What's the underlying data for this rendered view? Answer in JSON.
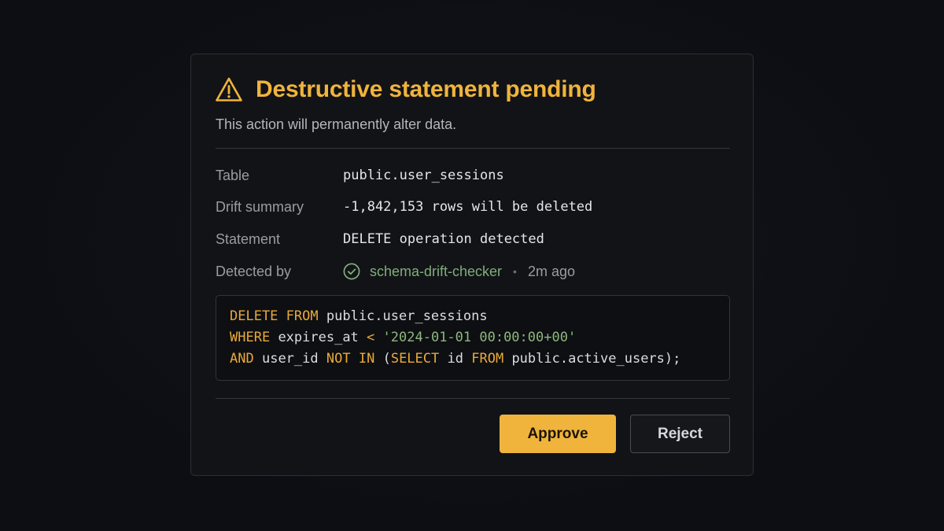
{
  "dialog": {
    "title": "Destructive statement pending",
    "subtitle": "This action will permanently alter data.",
    "warning_icon": "warning-triangle-icon",
    "colors": {
      "accent": "#f0b43c",
      "success": "#7fae7a",
      "background": "#121317"
    }
  },
  "details": [
    {
      "label": "Table",
      "value": "public.user_sessions"
    },
    {
      "label": "Drift summary",
      "value": "-1,842,153 rows will be deleted"
    },
    {
      "label": "Statement",
      "value": "DELETE operation detected"
    }
  ],
  "detected_by": {
    "label": "Detected by",
    "icon": "check-circle-icon",
    "checker": "schema-drift-checker",
    "separator": "•",
    "time_ago": "2m ago"
  },
  "sql": {
    "line1": {
      "kw1": "DELETE",
      "kw2": "FROM",
      "rest": "public.user_sessions"
    },
    "line2": {
      "kw1": "WHERE",
      "col": "expires_at",
      "op": "<",
      "str": "'2024-01-01 00:00:00+00'"
    },
    "line3": {
      "kw1": "AND",
      "col": "user_id",
      "kw2": "NOT",
      "kw3": "IN",
      "paren": "(",
      "kw4": "SELECT",
      "id": "id",
      "kw5": "FROM",
      "rest": "public.active_users);"
    }
  },
  "actions": {
    "approve_label": "Approve",
    "reject_label": "Reject"
  }
}
